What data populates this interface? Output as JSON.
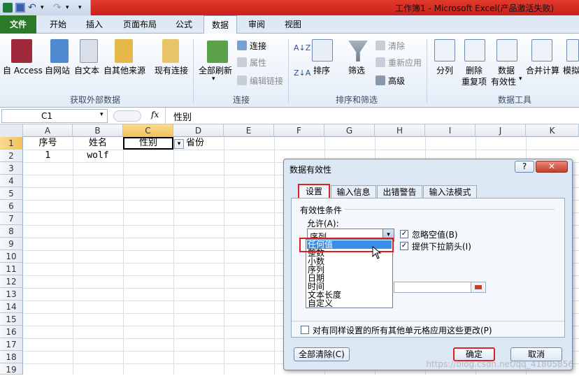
{
  "window": {
    "title": "工作簿1 - Microsoft Excel(产品激活失败)"
  },
  "tabs": [
    "文件",
    "开始",
    "插入",
    "页面布局",
    "公式",
    "数据",
    "审阅",
    "视图"
  ],
  "ribbon": {
    "group_external": {
      "label": "获取外部数据",
      "access": "自 Access",
      "web": "自网站",
      "text": "自文本",
      "other": "自其他来源",
      "existing": "现有连接"
    },
    "group_conn": {
      "label": "连接",
      "refresh": "全部刷新",
      "connections": "连接",
      "properties": "属性",
      "edit_links": "编辑链接"
    },
    "group_sort": {
      "label": "排序和筛选",
      "sort": "排序",
      "filter": "筛选",
      "clear": "清除",
      "reapply": "重新应用",
      "advanced": "高级",
      "az": "A↓Z",
      "za": "Z↓A"
    },
    "group_tools": {
      "label": "数据工具",
      "split": "分列",
      "dedupe1": "删除",
      "dedupe2": "重复项",
      "valid1": "数据",
      "valid2": "有效性",
      "consolidate": "合并计算",
      "whatif": "模拟"
    }
  },
  "formula_bar": {
    "cell_ref": "C1",
    "fx": "fx",
    "value": "性别"
  },
  "grid": {
    "columns": [
      "A",
      "B",
      "C",
      "D",
      "E",
      "F",
      "G",
      "H",
      "I",
      "J",
      "K"
    ],
    "rows": [
      "1",
      "2",
      "3",
      "4",
      "5",
      "6",
      "7",
      "8",
      "9",
      "10",
      "11",
      "12",
      "13",
      "14",
      "15",
      "16",
      "17",
      "18",
      "19"
    ],
    "r1": {
      "a": "序号",
      "b": "姓名",
      "c": "性别",
      "d": "省份"
    },
    "r2": {
      "a": "1",
      "b": "wolf"
    }
  },
  "dialog": {
    "title": "数据有效性",
    "help": "?",
    "close": "✕",
    "tabs": [
      "设置",
      "输入信息",
      "出错警告",
      "输入法模式"
    ],
    "criteria_label": "有效性条件",
    "allow_label": "允许(A):",
    "allow_value": "序列",
    "ignore_blank": "忽略空值(B)",
    "in_cell_dropdown": "提供下拉箭头(I)",
    "options": [
      "任何值",
      "整数",
      "小数",
      "序列",
      "日期",
      "时间",
      "文本长度",
      "自定义"
    ],
    "apply_all": "对有同样设置的所有其他单元格应用这些更改(P)",
    "clear_all": "全部清除(C)",
    "ok": "确定",
    "cancel": "取消"
  },
  "watermark": "https://blog.csdn.net/qq_41805856",
  "colors": {
    "title_red": "#d2261d",
    "file_green": "#2a7a2a",
    "highlight": "#3b8ee8",
    "annot_red": "#e02020"
  }
}
